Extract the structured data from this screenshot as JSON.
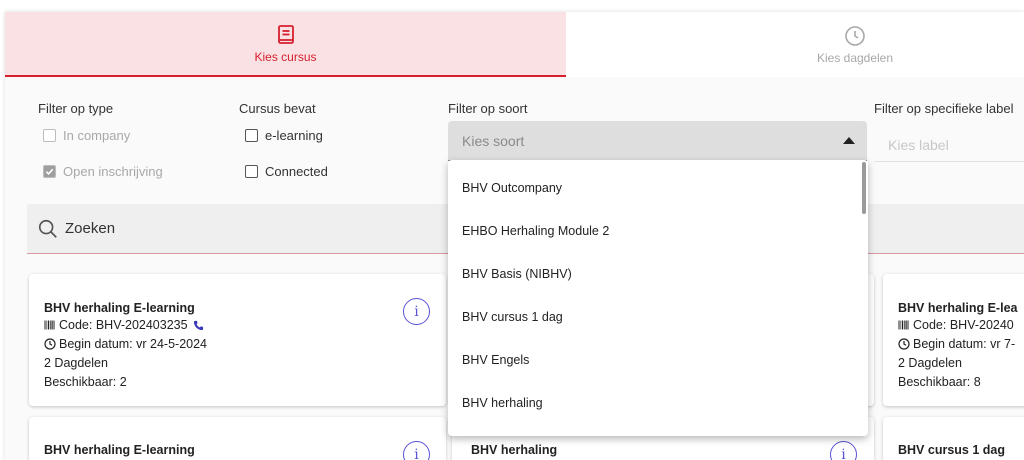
{
  "tabs": [
    {
      "label": "Kies cursus",
      "icon": "book-icon",
      "active": true
    },
    {
      "label": "Kies dagdelen",
      "icon": "clock-icon",
      "active": false
    }
  ],
  "filters": {
    "type": {
      "label": "Filter op type",
      "options": [
        {
          "label": "In company",
          "checked": false,
          "disabled": true
        },
        {
          "label": "Open inschrijving",
          "checked": true,
          "disabled": true
        }
      ]
    },
    "bevat": {
      "label": "Cursus bevat",
      "options": [
        {
          "label": "e-learning",
          "checked": false
        },
        {
          "label": "Connected",
          "checked": false
        }
      ]
    },
    "soort": {
      "label": "Filter op soort",
      "placeholder": "Kies soort",
      "menu_items": [
        "BHV Outcompany",
        "EHBO Herhaling Module 2",
        "BHV Basis (NIBHV)",
        "BHV cursus 1 dag",
        "BHV Engels",
        "BHV herhaling"
      ]
    },
    "label": {
      "label": "Filter op specifieke label",
      "placeholder": "Kies label"
    }
  },
  "search": {
    "placeholder": "Zoeken"
  },
  "cards": [
    {
      "title": "BHV herhaling E-learning",
      "code": "Code: BHV-202403235",
      "date": "Begin datum: vr 24-5-2024",
      "dagdelen": "2 Dagdelen",
      "beschikbaar": "Beschikbaar: 2"
    },
    {
      "title": "BHV herhaling E-lea",
      "code": "Code: BHV-20240",
      "date": "Begin datum: vr 7-",
      "dagdelen": "2 Dagdelen",
      "beschikbaar": "Beschikbaar: 8"
    },
    {
      "title": "BHV herhaling E-learning"
    },
    {
      "title": "BHV herhaling"
    },
    {
      "title": "BHV cursus 1 dag"
    }
  ],
  "colors": {
    "accent": "#d6202f",
    "info": "#5a52d8"
  }
}
